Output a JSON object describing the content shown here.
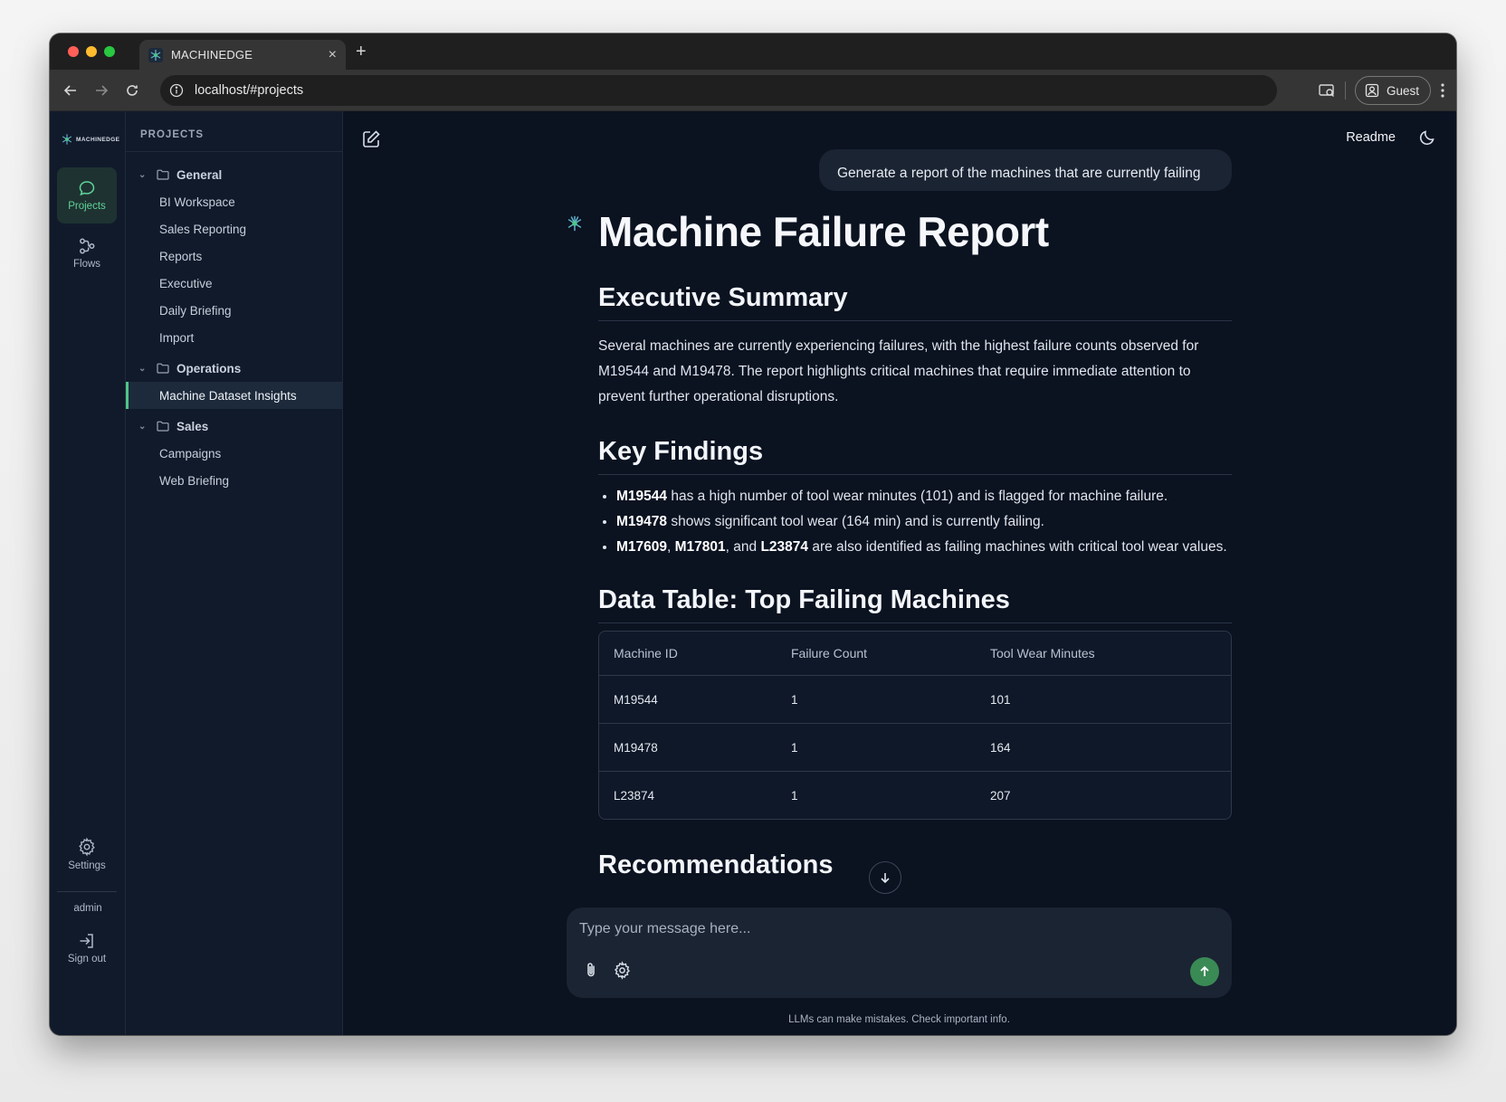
{
  "browser": {
    "tab_title": "MACHINEDGE",
    "new_tab": "+",
    "tab_close": "×",
    "url": "localhost/#projects",
    "profile_label": "Guest"
  },
  "rail": {
    "logo_text": "MACHINEDGE",
    "projects_label": "Projects",
    "flows_label": "Flows",
    "settings_label": "Settings",
    "username": "admin",
    "signout_label": "Sign out"
  },
  "sidebar": {
    "header": "PROJECTS",
    "folders": [
      {
        "name": "General",
        "items": [
          "BI Workspace",
          "Sales Reporting",
          "Reports",
          "Executive",
          "Daily Briefing",
          "Import"
        ]
      },
      {
        "name": "Operations",
        "items": [
          "Machine Dataset Insights"
        ]
      },
      {
        "name": "Sales",
        "items": [
          "Campaigns",
          "Web Briefing"
        ]
      }
    ],
    "active_item": "Machine Dataset Insights"
  },
  "header": {
    "readme_label": "Readme"
  },
  "chat": {
    "user_message": "Generate a report of the machines that are currently failing",
    "report": {
      "title": "Machine Failure Report",
      "summary_heading": "Executive Summary",
      "summary_text": "Several machines are currently experiencing failures, with the highest failure counts observed for M19544 and M19478. The report highlights critical machines that require immediate attention to prevent further operational disruptions.",
      "findings_heading": "Key Findings",
      "findings": [
        {
          "bold": "M19544",
          "text": " has a high number of tool wear minutes (101) and is flagged for machine failure."
        },
        {
          "bold": "M19478",
          "text": " shows significant tool wear (164 min) and is currently failing."
        },
        {
          "b1": "M17609",
          "t1": ", ",
          "b2": "M17801",
          "t2": ", and ",
          "b3": "L23874",
          "t3": " are also identified as failing machines with critical tool wear values."
        }
      ],
      "table_heading": "Data Table: Top Failing Machines",
      "table": {
        "columns": [
          "Machine ID",
          "Failure Count",
          "Tool Wear Minutes"
        ],
        "rows": [
          [
            "M19544",
            "1",
            "101"
          ],
          [
            "M19478",
            "1",
            "164"
          ],
          [
            "L23874",
            "1",
            "207"
          ]
        ]
      },
      "recommendations_heading": "Recommendations"
    }
  },
  "composer": {
    "placeholder": "Type your message here...",
    "disclaimer": "LLMs can make mistakes. Check important info."
  },
  "colors": {
    "accent": "#4fc58a",
    "send_button": "#3a8a55",
    "background": "#0b1220",
    "sidebar": "#111a2b"
  }
}
